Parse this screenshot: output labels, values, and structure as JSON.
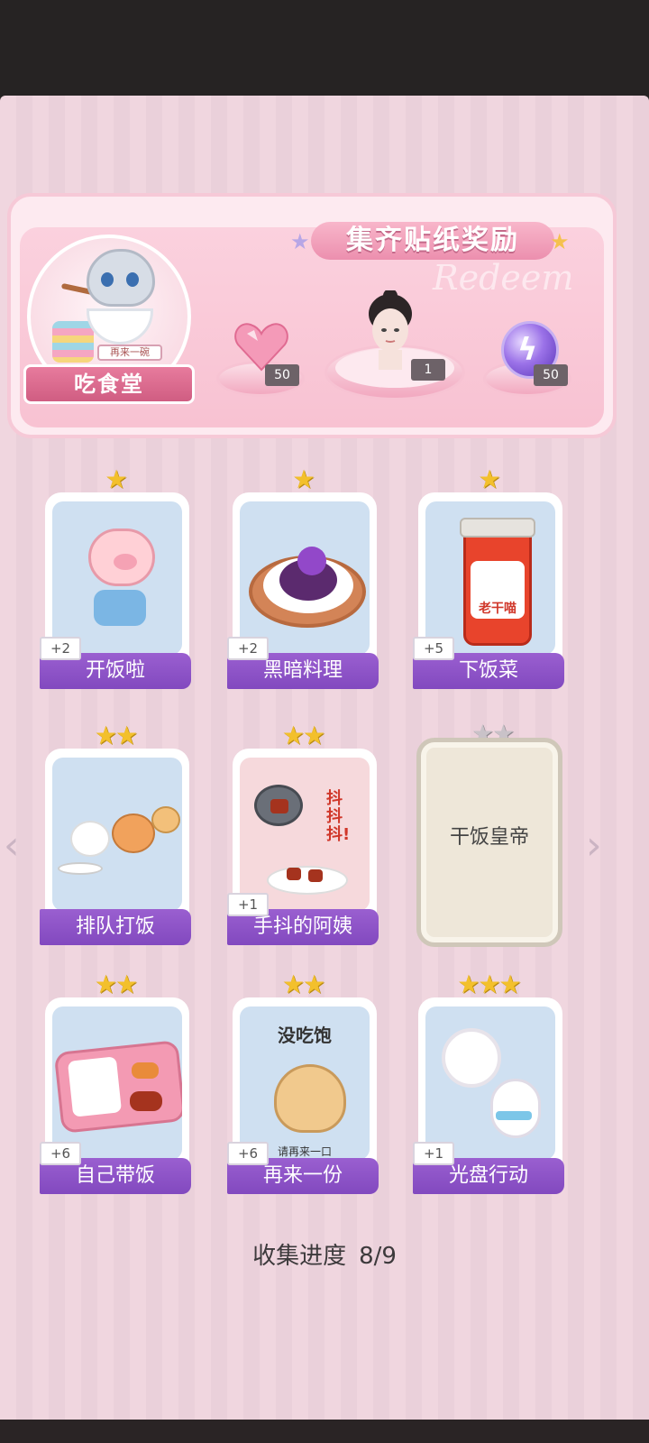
{
  "banner": {
    "title": "集齐贴纸奖励",
    "ghost_text": "Redeem",
    "canteen_label": "吃食堂",
    "canteen_sticker": "再来一碗",
    "rewards": [
      {
        "icon": "heart-gem-icon",
        "count": "50"
      },
      {
        "icon": "portrait-avatar",
        "count": "1"
      },
      {
        "icon": "lightning-orb-icon",
        "count": "50"
      }
    ]
  },
  "stickers": [
    {
      "label": "开饭啦",
      "stars": 1,
      "bonus": "+2",
      "collected": true
    },
    {
      "label": "黑暗料理",
      "stars": 1,
      "bonus": "+2",
      "collected": true
    },
    {
      "label": "下饭菜",
      "stars": 1,
      "bonus": "+5",
      "collected": true,
      "jar_text": "老干喵"
    },
    {
      "label": "排队打饭",
      "stars": 2,
      "bonus": "",
      "collected": true
    },
    {
      "label": "手抖的阿姨",
      "stars": 2,
      "bonus": "+1",
      "collected": true,
      "caption": "抖抖抖!"
    },
    {
      "label": "干饭皇帝",
      "stars": 2,
      "bonus": "",
      "collected": false
    },
    {
      "label": "自己带饭",
      "stars": 2,
      "bonus": "+6",
      "collected": true
    },
    {
      "label": "再来一份",
      "stars": 2,
      "bonus": "+6",
      "collected": true,
      "caption_top": "没吃饱",
      "caption_bottom": "请再来一口"
    },
    {
      "label": "光盘行动",
      "stars": 3,
      "bonus": "+1",
      "collected": true
    }
  ],
  "progress": {
    "label": "收集进度",
    "value": "8/9"
  },
  "colors": {
    "label_purple": "#8a4fc7",
    "star_gold": "#f3c02c",
    "panel_pink": "#f0d6df"
  }
}
